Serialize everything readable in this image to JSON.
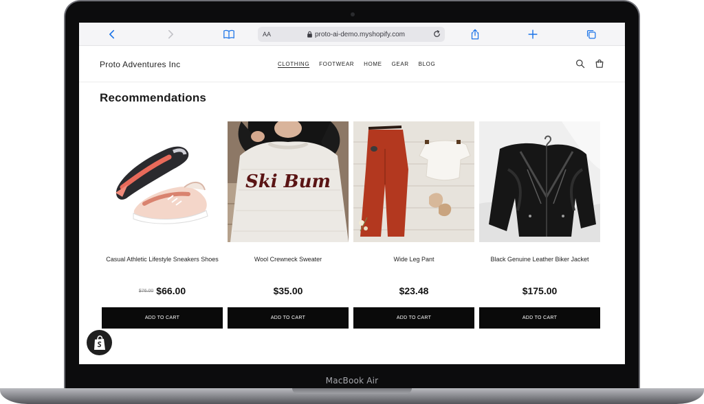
{
  "device": {
    "label": "MacBook Air"
  },
  "browser": {
    "text_size_label": "AA",
    "url": "proto-ai-demo.myshopify.com",
    "icons": [
      "back-icon",
      "forward-icon",
      "bookmarks-icon",
      "lock-icon",
      "reload-icon",
      "share-icon",
      "new-tab-icon",
      "tabs-icon"
    ],
    "accent_color": "#1a73e8"
  },
  "store": {
    "name": "Proto Adventures Inc",
    "nav": [
      {
        "label": "CLOTHING",
        "active": true
      },
      {
        "label": "FOOTWEAR",
        "active": false
      },
      {
        "label": "HOME",
        "active": false
      },
      {
        "label": "GEAR",
        "active": false
      },
      {
        "label": "BLOG",
        "active": false
      }
    ],
    "header_icons": [
      "search-icon",
      "cart-icon"
    ]
  },
  "main": {
    "section_title": "Recommendations",
    "products": [
      {
        "title": "Casual Athletic Lifestyle Sneakers Shoes",
        "old_price": "$76.00",
        "price": "$66.00",
        "button": "ADD TO CART",
        "image": "sneakers"
      },
      {
        "title": "Wool Crewneck Sweater",
        "old_price": "",
        "price": "$35.00",
        "button": "ADD TO CART",
        "image": "sweater"
      },
      {
        "title": "Wide Leg Pant",
        "old_price": "",
        "price": "$23.48",
        "button": "ADD TO CART",
        "image": "pants"
      },
      {
        "title": "Black Genuine Leather Biker Jacket",
        "old_price": "",
        "price": "$175.00",
        "button": "ADD TO CART",
        "image": "jacket"
      }
    ],
    "sweater_print": "Ski Bum"
  },
  "widgets": {
    "shopify_badge_icon": "shopify-bag-icon"
  }
}
